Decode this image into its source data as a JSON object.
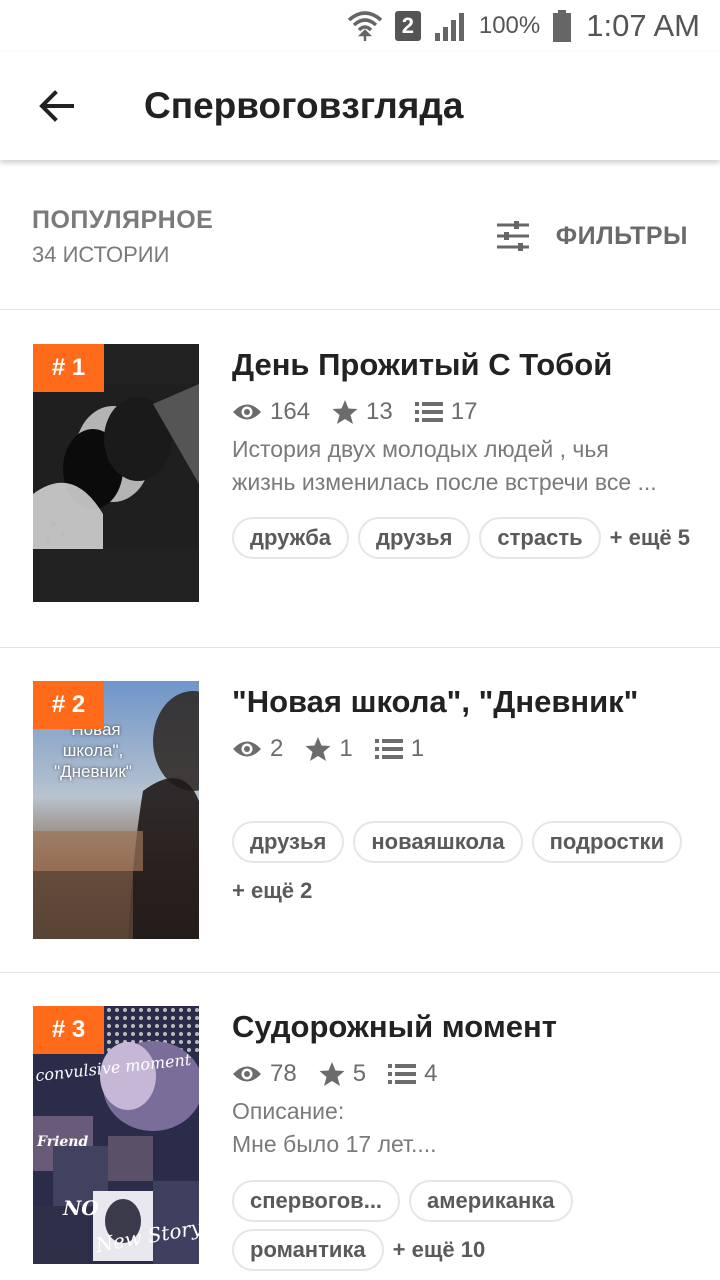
{
  "status_bar": {
    "sim": "2",
    "battery": "100%",
    "time": "1:07 AM"
  },
  "toolbar": {
    "title": "Спервоговзгляда"
  },
  "list_header": {
    "sort": "ПОПУЛЯРНОЕ",
    "count": "34 ИСТОРИИ",
    "filters_label": "ФИЛЬТРЫ"
  },
  "stories": [
    {
      "rank": "# 1",
      "title": "День Прожитый С Тобой",
      "views": "164",
      "votes": "13",
      "parts": "17",
      "desc": [
        "История двух молодых людей , чья",
        "жизнь изменилась после встречи все ..."
      ],
      "tags": [
        "дружба",
        "друзья",
        "страсть"
      ],
      "more": "+ ещё 5"
    },
    {
      "rank": "# 2",
      "title": "\"Новая школа\", \"Дневник\"",
      "views": "2",
      "votes": "1",
      "parts": "1",
      "desc": [],
      "tags": [
        "друзья",
        "новаяшкола",
        "подростки"
      ],
      "more": "+ ещё 2",
      "cover_text": [
        "\"Новая",
        "школа\",",
        "\"Дневник\""
      ]
    },
    {
      "rank": "# 3",
      "title": "Судорожный момент",
      "views": "78",
      "votes": "5",
      "parts": "4",
      "desc": [
        "Описание:",
        "Мне было 17 лет...."
      ],
      "tags": [
        "спервогов...",
        "американка",
        "романтика"
      ],
      "more": "+ ещё 10",
      "cover_text": [
        "convulsive moment",
        "Friend",
        "NO",
        "New Story"
      ]
    }
  ]
}
